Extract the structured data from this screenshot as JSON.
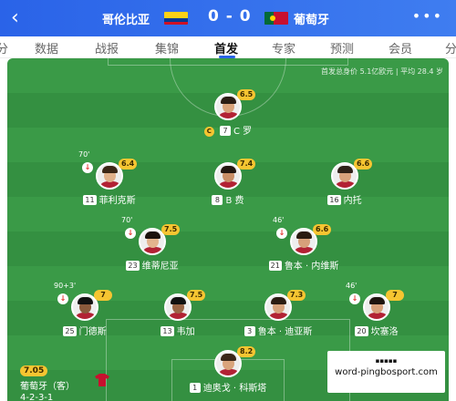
{
  "header": {
    "back_icon": "back-chevron-icon",
    "home_team": "哥伦比亚",
    "score": "0 - 0",
    "away_team": "葡萄牙",
    "more_icon": "more-dots-icon"
  },
  "tabs": [
    {
      "label": "分",
      "active": false
    },
    {
      "label": "数据",
      "active": false
    },
    {
      "label": "战报",
      "active": false
    },
    {
      "label": "集锦",
      "active": false
    },
    {
      "label": "首发",
      "active": true
    },
    {
      "label": "专家",
      "active": false
    },
    {
      "label": "预测",
      "active": false
    },
    {
      "label": "会员",
      "active": false
    },
    {
      "label": "分",
      "active": false
    }
  ],
  "lineup_info": "首发总身价 5.1亿欧元 | 平均 28.4 岁",
  "players": [
    {
      "name": "C 罗",
      "number": "7",
      "rating": "6.5",
      "captain": "C",
      "sub_time": ""
    },
    {
      "name": "菲利克斯",
      "number": "11",
      "rating": "6.4",
      "captain": "",
      "sub_time": "70'"
    },
    {
      "name": "B 费",
      "number": "8",
      "rating": "7.4",
      "captain": "",
      "sub_time": ""
    },
    {
      "name": "内托",
      "number": "16",
      "rating": "6.6",
      "captain": "",
      "sub_time": ""
    },
    {
      "name": "维蒂尼亚",
      "number": "23",
      "rating": "7.5",
      "captain": "",
      "sub_time": "70'"
    },
    {
      "name": "鲁本 · 内维斯",
      "number": "21",
      "rating": "6.6",
      "captain": "",
      "sub_time": "46'"
    },
    {
      "name": "门德斯",
      "number": "25",
      "rating": "7",
      "captain": "",
      "sub_time": "90+3'"
    },
    {
      "name": "韦加",
      "number": "13",
      "rating": "7.5",
      "captain": "",
      "sub_time": ""
    },
    {
      "name": "鲁本 · 迪亚斯",
      "number": "3",
      "rating": "7.3",
      "captain": "",
      "sub_time": ""
    },
    {
      "name": "坎塞洛",
      "number": "20",
      "rating": "7",
      "captain": "",
      "sub_time": "46'"
    },
    {
      "name": "迪奥戈 · 科斯塔",
      "number": "1",
      "rating": "8.2",
      "captain": "",
      "sub_time": ""
    }
  ],
  "team_summary": {
    "rating": "7.05",
    "name": "葡萄牙（客）",
    "formation": "4-2-3-1"
  },
  "watermark": {
    "top": "▪▪▪▪▪",
    "bottom": "word-pingbosport.com"
  },
  "colors": {
    "header": "#2a63e8",
    "pitch": "#3a9a47",
    "rating": "#f6c531"
  }
}
